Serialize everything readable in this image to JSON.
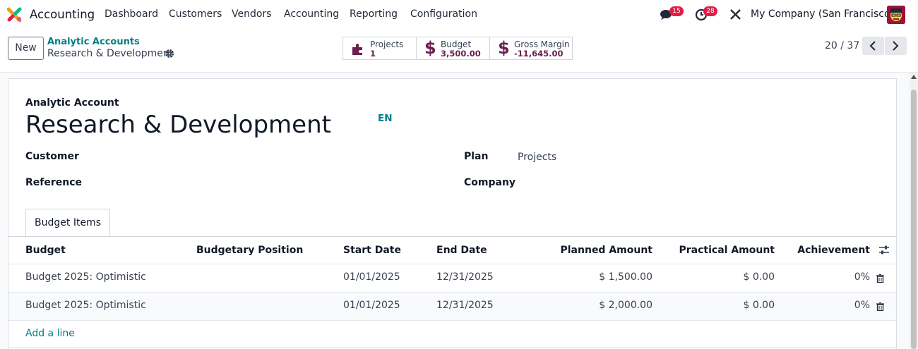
{
  "navbar": {
    "app_name": "Accounting",
    "menu": [
      "Dashboard",
      "Customers",
      "Vendors",
      "Accounting",
      "Reporting",
      "Configuration"
    ],
    "messages_count": "15",
    "activities_count": "28",
    "company": "My Company (San Francisco)",
    "icons": [
      "app-logo-icon",
      "chat-icon",
      "clock-icon",
      "tools-icon",
      "user-avatar"
    ]
  },
  "control": {
    "new_label": "New",
    "breadcrumb_parent": "Analytic Accounts",
    "breadcrumb_current": "Research & Development",
    "smart_buttons": [
      {
        "label": "Projects",
        "value": "1",
        "icon": "puzzle-icon"
      },
      {
        "label": "Budget",
        "value": "3,500.00",
        "icon": "dollar-icon"
      },
      {
        "label": "Gross Margin",
        "value": "-11,645.00",
        "icon": "dollar-icon"
      }
    ],
    "pager": "20 / 37"
  },
  "form": {
    "name_label": "Analytic Account",
    "name": "Research & Development",
    "lang": "EN",
    "customer_label": "Customer",
    "reference_label": "Reference",
    "plan_label": "Plan",
    "plan_value": "Projects",
    "company_label": "Company",
    "tab_label": "Budget Items",
    "columns": [
      "Budget",
      "Budgetary Position",
      "Start Date",
      "End Date",
      "Planned Amount",
      "Practical Amount",
      "Achievement"
    ],
    "rows": [
      {
        "budget": "Budget 2025: Optimistic",
        "position": "",
        "start": "01/01/2025",
        "end": "12/31/2025",
        "planned": "$ 1,500.00",
        "practical": "$ 0.00",
        "achievement": "0%"
      },
      {
        "budget": "Budget 2025: Optimistic",
        "position": "",
        "start": "01/01/2025",
        "end": "12/31/2025",
        "planned": "$ 2,000.00",
        "practical": "$ 0.00",
        "achievement": "0%"
      }
    ],
    "add_line": "Add a line"
  },
  "colors": {
    "accent": "#017e84",
    "brand": "#714b67",
    "badge": "#e11d48"
  }
}
